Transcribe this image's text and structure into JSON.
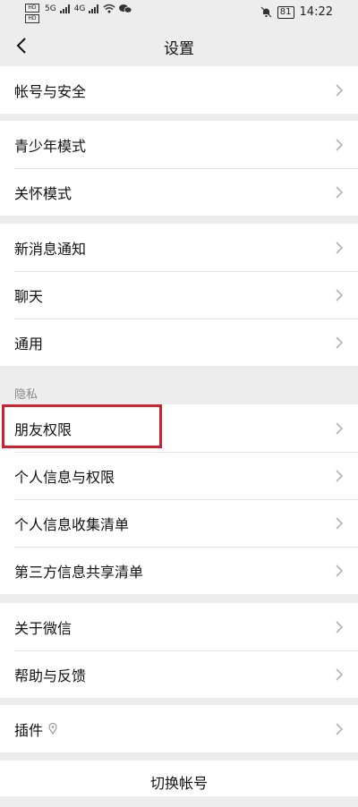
{
  "status_bar": {
    "sim1": "HD",
    "sim2": "HD",
    "net_speed": "5G",
    "net2": "4G",
    "battery": "81",
    "time": "14:22",
    "icons": [
      "mute-bell-icon",
      "wifi-icon",
      "wechat-icon",
      "battery-icon"
    ]
  },
  "nav": {
    "title": "设置",
    "back_icon": "chevron-left-icon"
  },
  "groups": [
    {
      "items": [
        {
          "label": "帐号与安全"
        }
      ]
    },
    {
      "items": [
        {
          "label": "青少年模式"
        },
        {
          "label": "关怀模式"
        }
      ]
    },
    {
      "items": [
        {
          "label": "新消息通知"
        },
        {
          "label": "聊天"
        },
        {
          "label": "通用"
        }
      ]
    },
    {
      "section_label": "隐私",
      "items": [
        {
          "label": "朋友权限",
          "highlighted": true
        },
        {
          "label": "个人信息与权限"
        },
        {
          "label": "个人信息收集清单"
        },
        {
          "label": "第三方信息共享清单"
        }
      ]
    },
    {
      "items": [
        {
          "label": "关于微信"
        },
        {
          "label": "帮助与反馈"
        }
      ]
    },
    {
      "items": [
        {
          "label": "插件",
          "icon": "location-pin-icon"
        }
      ]
    }
  ],
  "switch_account": "切换帐号",
  "colors": {
    "background": "#ededed",
    "card": "#ffffff",
    "highlight_border": "#d32030",
    "chevron": "#b2b2b2"
  }
}
